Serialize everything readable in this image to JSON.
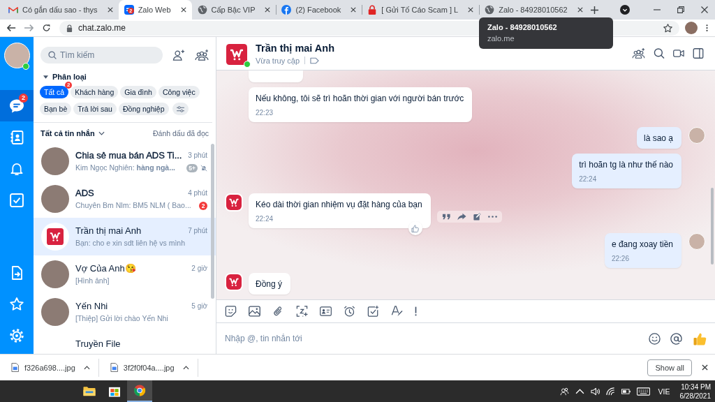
{
  "browser": {
    "tabs": [
      {
        "title": "Có gắn dấu sao - thys",
        "kind": "gmail",
        "selected": false
      },
      {
        "title": "Zalo Web",
        "kind": "zalo",
        "badge": "2",
        "selected": true
      },
      {
        "title": "Cấp Bậc VIP",
        "kind": "globe",
        "selected": false
      },
      {
        "title": "(2) Facebook",
        "kind": "facebook",
        "selected": false
      },
      {
        "title": "[ Gửi Tố Cáo Scam ] L",
        "kind": "lock",
        "selected": false
      },
      {
        "title": "Zalo - 84928010562",
        "kind": "globe",
        "selected": false
      }
    ],
    "address": "chat.zalo.me",
    "tooltip": {
      "title": "Zalo - 84928010562",
      "url": "zalo.me"
    }
  },
  "nav": {
    "online": true,
    "items": [
      {
        "kind": "chat",
        "badge": "2",
        "selected": true
      },
      {
        "kind": "contacts",
        "selected": false
      },
      {
        "kind": "bell",
        "selected": false
      },
      {
        "kind": "todo",
        "selected": false
      }
    ],
    "bottom_items": [
      {
        "kind": "file",
        "selected": false
      },
      {
        "kind": "star",
        "selected": false
      },
      {
        "kind": "gear",
        "selected": false
      }
    ]
  },
  "sidebar": {
    "search_placeholder": "Tìm kiếm",
    "category_title": "Phân loại",
    "categories": [
      {
        "label": "Tất cả",
        "badge": "2",
        "selected": true
      },
      {
        "label": "Khách hàng",
        "selected": false
      },
      {
        "label": "Gia đình",
        "selected": false
      },
      {
        "label": "Công việc",
        "selected": false
      },
      {
        "label": "Bạn bè",
        "selected": false
      },
      {
        "label": "Trả lời sau",
        "selected": false
      },
      {
        "label": "Đồng nghiệp",
        "selected": false
      }
    ],
    "list_filter": "Tất cả tin nhắn",
    "mark_read": "Đánh dấu đã đọc",
    "conversations": [
      {
        "name": "Chia sẻ mua bán ADS Ti...",
        "time": "3 phút",
        "preview": "Kim Ngọc Nghiên: **hàng ngà...**",
        "avatar": {
          "kind": "photo"
        },
        "badge": "5+",
        "muted": true,
        "selected": false
      },
      {
        "name": "ADS",
        "time": "4 phút",
        "preview": "Chuyên Bm Nlm: BM5 NLM ( Bao...",
        "avatar": {
          "kind": "photo"
        },
        "badge": "2",
        "muted": false,
        "selected": false
      },
      {
        "name": "Trần thị mai Anh",
        "time": "7 phút",
        "preview": "Bạn: cho e xin sdt liên hệ vs mình",
        "avatar": {
          "kind": "shop-logo"
        },
        "muted": false,
        "selected": true
      },
      {
        "name": "Vợ Của Anh😘",
        "time": "2 giờ",
        "preview": "[Hình ảnh]",
        "avatar": {
          "kind": "photo"
        },
        "muted": false,
        "selected": false
      },
      {
        "name": "Yến Nhi",
        "time": "5 giờ",
        "preview": "[Thiệp] Gửi lời chào Yến Nhi",
        "avatar": {
          "kind": "photo"
        },
        "muted": false,
        "selected": false
      },
      {
        "name": "Truyền File",
        "muted": false,
        "selected": false
      }
    ]
  },
  "chat": {
    "contact": {
      "name": "Trần thị mai Anh",
      "status": "Vừa truy cập",
      "online": true
    },
    "messages": [
      {
        "outgoing": false,
        "kind": "fragment",
        "avatar": false
      },
      {
        "outgoing": false,
        "kind": "text",
        "text": "Nếu không, tôi sẽ trì hoãn thời gian với người bán trước",
        "time": "22:23",
        "avatar": false
      },
      {
        "outgoing": true,
        "kind": "text",
        "text": "là sao ạ",
        "avatar": true
      },
      {
        "outgoing": true,
        "kind": "text",
        "text": "trì hoãn tg là như thế nào",
        "time": "22:24",
        "avatar": false
      },
      {
        "outgoing": false,
        "kind": "text",
        "text": "Kéo dài thời gian nhiệm vụ đặt hàng của bạn",
        "time": "22:24",
        "avatar": true,
        "hovered": true
      },
      {
        "outgoing": true,
        "kind": "text",
        "text": "e đang xoay tiền",
        "time": "22:26",
        "avatar": true
      },
      {
        "outgoing": false,
        "kind": "text",
        "text": "Đồng ý",
        "avatar": true
      }
    ],
    "input_placeholder": "Nhập @, tin nhắn tới"
  },
  "downloads": {
    "files": [
      {
        "name": "f326a698....jpg"
      },
      {
        "name": "3f2f0f04a....jpg"
      }
    ],
    "show_all": "Show all"
  },
  "taskbar": {
    "apps": [
      {
        "kind": "explorer",
        "active": false
      },
      {
        "kind": "store",
        "active": false
      },
      {
        "kind": "chrome",
        "active": true
      }
    ],
    "language": "VIE",
    "time": "10:34 PM",
    "date": "6/28/2021"
  }
}
